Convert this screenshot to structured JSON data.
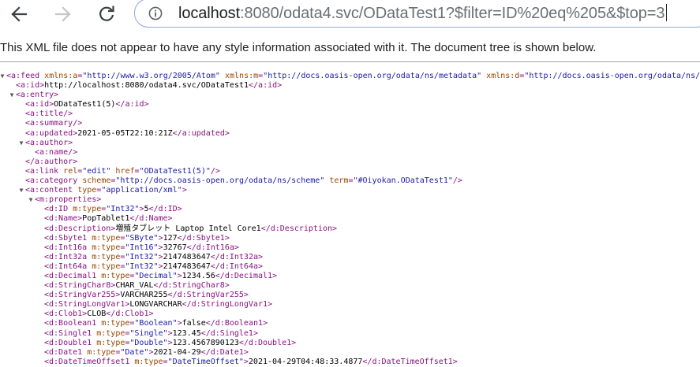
{
  "browser": {
    "url_host": "localhost",
    "url_rest": ":8080/odata4.svc/ODataTest1?$filter=ID%20eq%205&$top=3"
  },
  "notice": "This XML file does not appear to have any style information associated with it. The document tree is shown below.",
  "tree": [
    {
      "depth": 0,
      "tog": "▼",
      "segs": [
        [
          "t",
          "<a:feed "
        ],
        [
          "n",
          "xmlns:a"
        ],
        [
          "t",
          "="
        ],
        [
          "v",
          "\"http://www.w3.org/2005/Atom\""
        ],
        [
          "t",
          " "
        ],
        [
          "n",
          "xmlns:m"
        ],
        [
          "t",
          "="
        ],
        [
          "v",
          "\"http://docs.oasis-open.org/odata/ns/metadata\""
        ],
        [
          "t",
          " "
        ],
        [
          "n",
          "xmlns:d"
        ],
        [
          "t",
          "="
        ],
        [
          "v",
          "\"http://docs.oasis-open.org/odata/ns/d"
        ]
      ]
    },
    {
      "depth": 1,
      "tog": "",
      "segs": [
        [
          "t",
          "<a:id>"
        ],
        [
          "x",
          "http://localhost:8080/odata4.svc/ODataTest1"
        ],
        [
          "t",
          "</a:id>"
        ]
      ]
    },
    {
      "depth": 1,
      "tog": "▼",
      "segs": [
        [
          "t",
          "<a:entry>"
        ]
      ]
    },
    {
      "depth": 2,
      "tog": "",
      "segs": [
        [
          "t",
          "<a:id>"
        ],
        [
          "x",
          "ODataTest1(5)"
        ],
        [
          "t",
          "</a:id>"
        ]
      ]
    },
    {
      "depth": 2,
      "tog": "",
      "segs": [
        [
          "t",
          "<a:title/>"
        ]
      ]
    },
    {
      "depth": 2,
      "tog": "",
      "segs": [
        [
          "t",
          "<a:summary/>"
        ]
      ]
    },
    {
      "depth": 2,
      "tog": "",
      "segs": [
        [
          "t",
          "<a:updated>"
        ],
        [
          "x",
          "2021-05-05T22:10:21Z"
        ],
        [
          "t",
          "</a:updated>"
        ]
      ]
    },
    {
      "depth": 2,
      "tog": "▼",
      "segs": [
        [
          "t",
          "<a:author>"
        ]
      ]
    },
    {
      "depth": 3,
      "tog": "",
      "segs": [
        [
          "t",
          "<a:name/>"
        ]
      ]
    },
    {
      "depth": 2,
      "tog": "",
      "segs": [
        [
          "t",
          "</a:author>"
        ]
      ]
    },
    {
      "depth": 2,
      "tog": "",
      "segs": [
        [
          "t",
          "<a:link "
        ],
        [
          "n",
          "rel"
        ],
        [
          "t",
          "="
        ],
        [
          "v",
          "\"edit\""
        ],
        [
          "t",
          " "
        ],
        [
          "n",
          "href"
        ],
        [
          "t",
          "="
        ],
        [
          "v",
          "\"ODataTest1(5)\""
        ],
        [
          "t",
          "/>"
        ]
      ]
    },
    {
      "depth": 2,
      "tog": "",
      "segs": [
        [
          "t",
          "<a:category "
        ],
        [
          "n",
          "scheme"
        ],
        [
          "t",
          "="
        ],
        [
          "v",
          "\"http://docs.oasis-open.org/odata/ns/scheme\""
        ],
        [
          "t",
          " "
        ],
        [
          "n",
          "term"
        ],
        [
          "t",
          "="
        ],
        [
          "v",
          "\"#Oiyokan.ODataTest1\""
        ],
        [
          "t",
          "/>"
        ]
      ]
    },
    {
      "depth": 2,
      "tog": "▼",
      "segs": [
        [
          "t",
          "<a:content "
        ],
        [
          "n",
          "type"
        ],
        [
          "t",
          "="
        ],
        [
          "v",
          "\"application/xml\""
        ],
        [
          "t",
          ">"
        ]
      ]
    },
    {
      "depth": 3,
      "tog": "▼",
      "segs": [
        [
          "t",
          "<m:properties>"
        ]
      ]
    },
    {
      "depth": 4,
      "tog": "",
      "segs": [
        [
          "t",
          "<d:ID "
        ],
        [
          "n",
          "m:type"
        ],
        [
          "t",
          "="
        ],
        [
          "v",
          "\"Int32\""
        ],
        [
          "t",
          ">"
        ],
        [
          "x",
          "5"
        ],
        [
          "t",
          "</d:ID>"
        ]
      ]
    },
    {
      "depth": 4,
      "tog": "",
      "segs": [
        [
          "t",
          "<d:Name>"
        ],
        [
          "x",
          "PopTablet1"
        ],
        [
          "t",
          "</d:Name>"
        ]
      ]
    },
    {
      "depth": 4,
      "tog": "",
      "segs": [
        [
          "t",
          "<d:Description>"
        ],
        [
          "x",
          "増殖タブレット Laptop Intel Core1"
        ],
        [
          "t",
          "</d:Description>"
        ]
      ]
    },
    {
      "depth": 4,
      "tog": "",
      "segs": [
        [
          "t",
          "<d:Sbyte1 "
        ],
        [
          "n",
          "m:type"
        ],
        [
          "t",
          "="
        ],
        [
          "v",
          "\"SByte\""
        ],
        [
          "t",
          ">"
        ],
        [
          "x",
          "127"
        ],
        [
          "t",
          "</d:Sbyte1>"
        ]
      ]
    },
    {
      "depth": 4,
      "tog": "",
      "segs": [
        [
          "t",
          "<d:Int16a "
        ],
        [
          "n",
          "m:type"
        ],
        [
          "t",
          "="
        ],
        [
          "v",
          "\"Int16\""
        ],
        [
          "t",
          ">"
        ],
        [
          "x",
          "32767"
        ],
        [
          "t",
          "</d:Int16a>"
        ]
      ]
    },
    {
      "depth": 4,
      "tog": "",
      "segs": [
        [
          "t",
          "<d:Int32a "
        ],
        [
          "n",
          "m:type"
        ],
        [
          "t",
          "="
        ],
        [
          "v",
          "\"Int32\""
        ],
        [
          "t",
          ">"
        ],
        [
          "x",
          "2147483647"
        ],
        [
          "t",
          "</d:Int32a>"
        ]
      ]
    },
    {
      "depth": 4,
      "tog": "",
      "segs": [
        [
          "t",
          "<d:Int64a "
        ],
        [
          "n",
          "m:type"
        ],
        [
          "t",
          "="
        ],
        [
          "v",
          "\"Int32\""
        ],
        [
          "t",
          ">"
        ],
        [
          "x",
          "2147483647"
        ],
        [
          "t",
          "</d:Int64a>"
        ]
      ]
    },
    {
      "depth": 4,
      "tog": "",
      "segs": [
        [
          "t",
          "<d:Decimal1 "
        ],
        [
          "n",
          "m:type"
        ],
        [
          "t",
          "="
        ],
        [
          "v",
          "\"Decimal\""
        ],
        [
          "t",
          ">"
        ],
        [
          "x",
          "1234.56"
        ],
        [
          "t",
          "</d:Decimal1>"
        ]
      ]
    },
    {
      "depth": 4,
      "tog": "",
      "segs": [
        [
          "t",
          "<d:StringChar8>"
        ],
        [
          "x",
          "CHAR_VAL"
        ],
        [
          "t",
          "</d:StringChar8>"
        ]
      ]
    },
    {
      "depth": 4,
      "tog": "",
      "segs": [
        [
          "t",
          "<d:StringVar255>"
        ],
        [
          "x",
          "VARCHAR255"
        ],
        [
          "t",
          "</d:StringVar255>"
        ]
      ]
    },
    {
      "depth": 4,
      "tog": "",
      "segs": [
        [
          "t",
          "<d:StringLongVar1>"
        ],
        [
          "x",
          "LONGVARCHAR"
        ],
        [
          "t",
          "</d:StringLongVar1>"
        ]
      ]
    },
    {
      "depth": 4,
      "tog": "",
      "segs": [
        [
          "t",
          "<d:Clob1>"
        ],
        [
          "x",
          "CLOB"
        ],
        [
          "t",
          "</d:Clob1>"
        ]
      ]
    },
    {
      "depth": 4,
      "tog": "",
      "segs": [
        [
          "t",
          "<d:Boolean1 "
        ],
        [
          "n",
          "m:type"
        ],
        [
          "t",
          "="
        ],
        [
          "v",
          "\"Boolean\""
        ],
        [
          "t",
          ">"
        ],
        [
          "x",
          "false"
        ],
        [
          "t",
          "</d:Boolean1>"
        ]
      ]
    },
    {
      "depth": 4,
      "tog": "",
      "segs": [
        [
          "t",
          "<d:Single1 "
        ],
        [
          "n",
          "m:type"
        ],
        [
          "t",
          "="
        ],
        [
          "v",
          "\"Single\""
        ],
        [
          "t",
          ">"
        ],
        [
          "x",
          "123.45"
        ],
        [
          "t",
          "</d:Single1>"
        ]
      ]
    },
    {
      "depth": 4,
      "tog": "",
      "segs": [
        [
          "t",
          "<d:Double1 "
        ],
        [
          "n",
          "m:type"
        ],
        [
          "t",
          "="
        ],
        [
          "v",
          "\"Double\""
        ],
        [
          "t",
          ">"
        ],
        [
          "x",
          "123.4567890123"
        ],
        [
          "t",
          "</d:Double1>"
        ]
      ]
    },
    {
      "depth": 4,
      "tog": "",
      "segs": [
        [
          "t",
          "<d:Date1 "
        ],
        [
          "n",
          "m:type"
        ],
        [
          "t",
          "="
        ],
        [
          "v",
          "\"Date\""
        ],
        [
          "t",
          ">"
        ],
        [
          "x",
          "2021-04-29"
        ],
        [
          "t",
          "</d:Date1>"
        ]
      ]
    },
    {
      "depth": 4,
      "tog": "",
      "segs": [
        [
          "t",
          "<d:DateTimeOffset1 "
        ],
        [
          "n",
          "m:type"
        ],
        [
          "t",
          "="
        ],
        [
          "v",
          "\"DateTimeOffset\""
        ],
        [
          "t",
          ">"
        ],
        [
          "x",
          "2021-04-29T04:48:33.4877"
        ],
        [
          "t",
          "</d:DateTimeOffset1>"
        ]
      ]
    }
  ]
}
